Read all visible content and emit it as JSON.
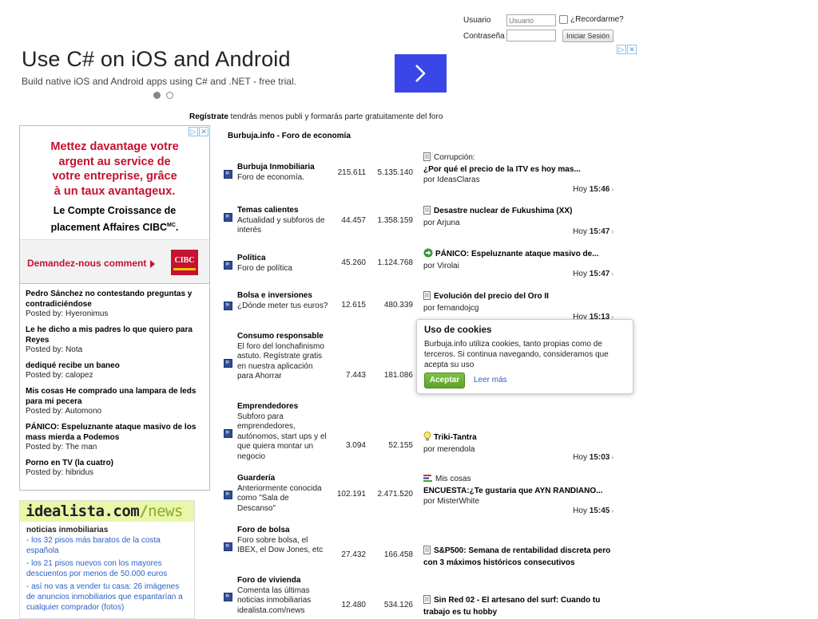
{
  "login": {
    "user_label": "Usuario",
    "user_placeholder": "Usuario",
    "remember_label": "¿Recordarme?",
    "password_label": "Contraseña",
    "login_button": "Iniciar Sesión"
  },
  "top_ad": {
    "headline": "Use C# on iOS and Android",
    "subtext": "Build native iOS and Android apps using C# and .NET - free trial.",
    "adchoices_icon": "info-icon",
    "close_icon": "close-icon"
  },
  "register": {
    "link": "Regístrate",
    "text": " tendrás menos publi y formarás parte gratuitamente del foro"
  },
  "cibc_ad": {
    "red_lines": [
      "Mettez davantage votre",
      "argent au service de",
      "votre entreprise, grâce",
      "à un taux avantageux."
    ],
    "black_lines": [
      "Le Compte Croissance de",
      "placement Affaires CIBC"
    ],
    "black_superscript": "MC",
    "cta": "Demandez-nous comment",
    "logo_text": "CIBC",
    "brand_color": "#c41230"
  },
  "left_posts": [
    {
      "title": "Pedro Sánchez no contestando preguntas y contradiciéndose",
      "by": "Posted by: Hyeronimus"
    },
    {
      "title": "Le he dicho a mis padres lo que quiero para Reyes",
      "by": "Posted by: Nota"
    },
    {
      "title": "dediqué recibe un baneo",
      "by": "Posted by: calopez"
    },
    {
      "title": "Mis cosas He comprado una lampara de leds para mi pecera",
      "by": "Posted by: Automono"
    },
    {
      "title": "PÁNICO: Espeluznante ataque masivo de los mass mierda a Podemos",
      "by": "Posted by: The man"
    },
    {
      "title": "Porno en TV (la cuatro)",
      "by": "Posted by: hibridus"
    }
  ],
  "idealista": {
    "brand_part1": "idealista.com",
    "brand_slash": "/",
    "brand_part2": "news",
    "category": "noticias inmobiliarias",
    "links": [
      "- los 32 pisos más baratos de la costa española",
      "- los 21 pisos nuevos con los mayores descuentos por menos de 50.000 euros",
      "- así no vas a vender tu casa: 26 imágenes de anuncios inmobiliarios que espantarían a cualquier comprador (fotos)"
    ],
    "accent_color": "#e8f7a8"
  },
  "forum": {
    "header": "Burbuja.info - Foro de economía",
    "rows": [
      {
        "name": "Burbuja Inmobiliaria",
        "desc": "Foro de economía.",
        "threads": "215.611",
        "messages": "5.135.140",
        "last_prefix": "Corrupción:",
        "last_title": "¿Por qué el precio de la ITV es hoy mas...",
        "last_by": "por IdeasClaras",
        "last_day": "Hoy",
        "last_time": "15:46",
        "icon": "document-icon"
      },
      {
        "name": "Temas calientes",
        "desc": "Actualidad y subforos de interés",
        "threads": "44.457",
        "messages": "1.358.159",
        "last_prefix": "",
        "last_title": "Desastre nuclear de Fukushima (XX)",
        "last_by": "por Arjuna",
        "last_day": "Hoy",
        "last_time": "15:47",
        "icon": "document-icon"
      },
      {
        "name": "Política",
        "desc": "Foro de política",
        "threads": "45.260",
        "messages": "1.124.768",
        "last_prefix": "",
        "last_title": "PÁNICO: Espeluznante ataque masivo de...",
        "last_by": "por Virolai",
        "last_day": "Hoy",
        "last_time": "15:47",
        "icon": "arrow-right-circle-icon"
      },
      {
        "name": "Bolsa e inversiones",
        "desc": "¿Dónde meter tus euros?",
        "threads": "12.615",
        "messages": "480.339",
        "last_prefix": "",
        "last_title": "Evolución del precio del Oro II",
        "last_by": "por fernandojcg",
        "last_day": "Hoy",
        "last_time": "15:13",
        "icon": "document-icon"
      },
      {
        "name": "Consumo responsable",
        "desc": "El foro del lonchafinismo astuto. Regístrate gratis en nuestra aplicación para Ahorrar",
        "threads": "7.443",
        "messages": "181.086",
        "last_prefix": "",
        "last_title": "",
        "last_by": "",
        "last_day": "",
        "last_time": "",
        "icon": ""
      },
      {
        "name": "Emprendedores",
        "desc": "Subforo para emprendedores, autónomos, start ups y el que quiera montar un negocio",
        "threads": "3.094",
        "messages": "52.155",
        "last_prefix": "",
        "last_title": "Triki-Tantra",
        "last_by": "por merendola",
        "last_day": "Hoy",
        "last_time": "15:03",
        "icon": "lightbulb-icon"
      },
      {
        "name": "Guardería",
        "desc": "Anteriormente conocida como \"Sala de Descanso\"",
        "threads": "102.191",
        "messages": "2.471.520",
        "last_prefix": "Mis cosas",
        "last_title": "ENCUESTA:¿Te gustaria que AYN RANDIANO...",
        "last_by": "por MisterWhite",
        "last_day": "Hoy",
        "last_time": "15:45",
        "icon": "poll-icon"
      },
      {
        "name": "Foro de bolsa",
        "desc": "Foro sobre bolsa, el IBEX, el Dow Jones, etc",
        "threads": "27.432",
        "messages": "166.458",
        "last_prefix": "",
        "last_title": "S&P500: Semana de rentabilidad discreta pero",
        "last_title2": "con 3 máximos históricos consecutivos",
        "last_by": "",
        "last_day": "",
        "last_time": "",
        "icon": "document-icon"
      },
      {
        "name": "Foro de vivienda",
        "desc": "Comenta las últimas noticias inmobiliarias idealista.com/news",
        "threads": "12.480",
        "messages": "534.126",
        "last_prefix": "",
        "last_title": "Sin Red 02 - El artesano del surf: Cuando tu",
        "last_title2": "trabajo es tu hobby",
        "last_by": "",
        "last_day": "",
        "last_time": "",
        "icon": "document-icon"
      }
    ]
  },
  "cookie": {
    "title": "Uso de cookies",
    "text": "Burbuja.info utiliza cookies, tanto propias como de terceros. Si continua navegando, consideramos que acepta su uso",
    "accept": "Aceptar",
    "more": "Leer más",
    "accept_color": "#5fa12d"
  }
}
